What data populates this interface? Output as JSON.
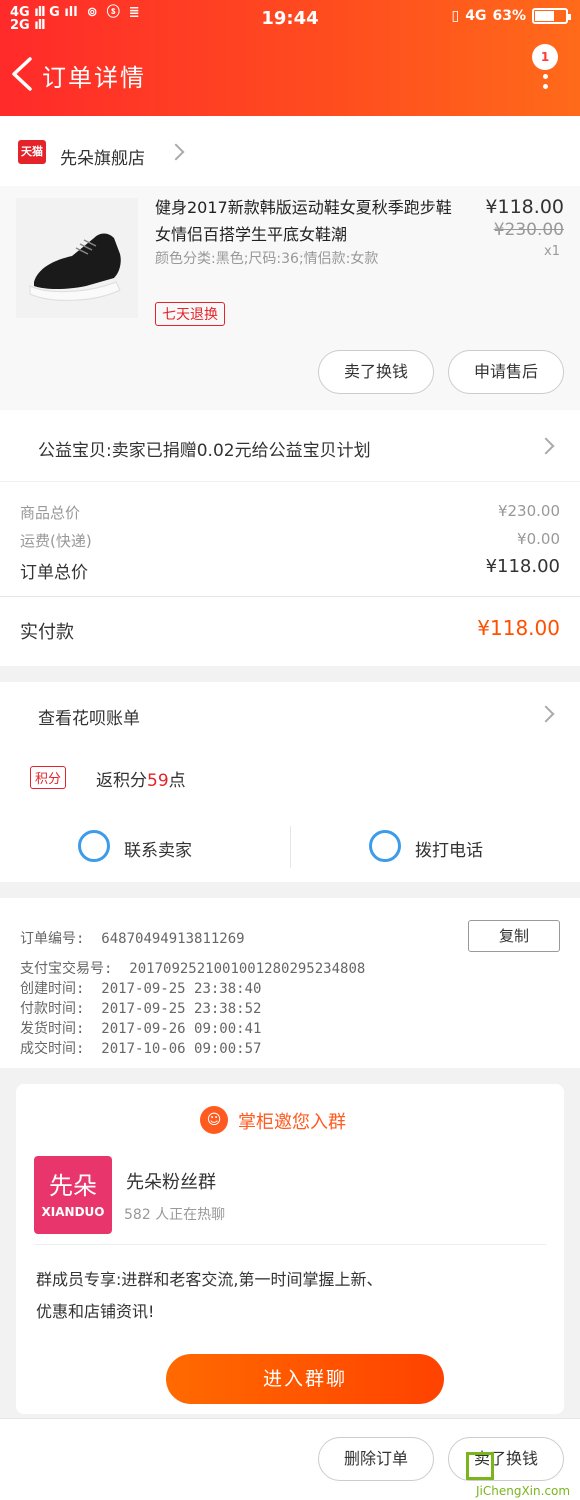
{
  "status_bar": {
    "left_top": "4G",
    "left_bottom": "2G",
    "network_g": "G",
    "time": "19:44",
    "network_right": "4G",
    "battery": "63%",
    "battery_level": 0.63
  },
  "header": {
    "title": "订单详情",
    "badge": "1"
  },
  "store": {
    "logo_text": "天猫",
    "name": "先朵旗舰店"
  },
  "product": {
    "title": "健身2017新款韩版运动鞋女夏秋季跑步鞋女情侣百搭学生平底女鞋潮",
    "spec": "颜色分类:黑色;尺码:36;情侣款:女款",
    "price": "¥118.00",
    "original_price": "¥230.00",
    "quantity": "x1",
    "tag": "七天退换",
    "btn_sold_exchange": "卖了换钱",
    "btn_after_sale": "申请售后"
  },
  "charity": {
    "text": "公益宝贝:卖家已捐赠0.02元给公益宝贝计划"
  },
  "summary": {
    "goods_total_label": "商品总价",
    "goods_total": "¥230.00",
    "shipping_label": "运费(快递)",
    "shipping": "¥0.00",
    "order_total_label": "订单总价",
    "order_total": "¥118.00",
    "paid_label": "实付款",
    "paid": "¥118.00"
  },
  "huabei": {
    "text": "查看花呗账单"
  },
  "points": {
    "badge": "积分",
    "prefix": "返积分",
    "value": "59",
    "suffix": "点"
  },
  "contact": {
    "seller": "联系卖家",
    "phone": "拨打电话"
  },
  "order_info": {
    "order_no_label": "订单编号:",
    "order_no": "64870494913811269",
    "copy": "复制",
    "alipay_label": "支付宝交易号:",
    "alipay_no": "2017092521001001280295234808",
    "created_label": "创建时间:",
    "created": "2017-09-25  23:38:40",
    "paid_label": "付款时间:",
    "paid": "2017-09-25  23:38:52",
    "shipped_label": "发货时间:",
    "shipped": "2017-09-26  09:00:41",
    "done_label": "成交时间:",
    "done": "2017-10-06  09:00:57"
  },
  "group": {
    "invite": "掌柜邀您入群",
    "logo_cn": "先朵",
    "logo_en": "XIANDUO",
    "name": "先朵粉丝群",
    "online": "582 人正在热聊",
    "desc_line1": "群成员专享:进群和老客交流,第一时间掌握上新、",
    "desc_line2": "优惠和店铺资讯!",
    "join": "进入群聊"
  },
  "bottom": {
    "delete": "删除订单",
    "sell": "卖了换钱"
  },
  "watermark": {
    "text": "JiChengXin.com"
  }
}
